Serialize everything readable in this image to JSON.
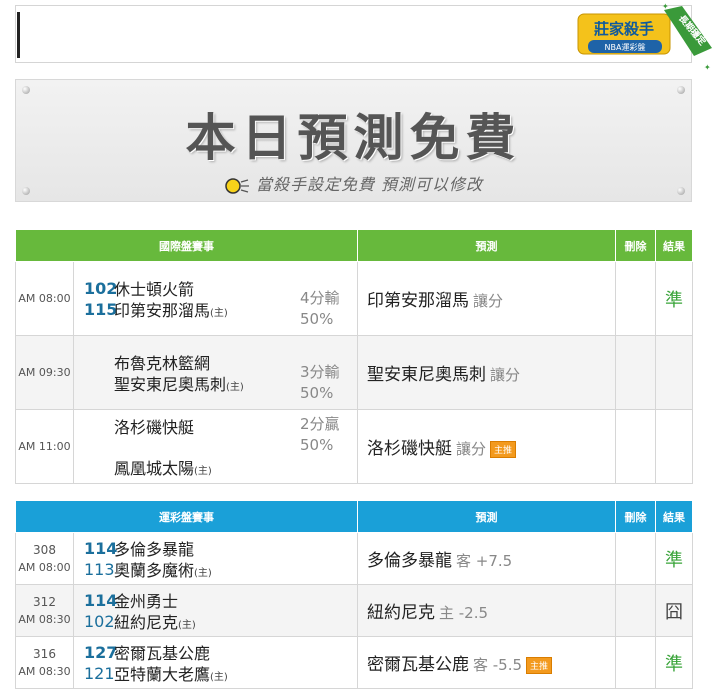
{
  "badge": {
    "main": "莊家殺手",
    "sub": "NBA運彩盤",
    "ribbon": "長期穩定"
  },
  "banner": {
    "title": "本日預測免費",
    "subtitle": "當殺手設定免費  預測可以修改"
  },
  "intl_table": {
    "headers": {
      "match": "國際盤賽事",
      "pred": "預測",
      "del": "刪除",
      "result": "結果"
    },
    "rows": [
      {
        "time": "AM 08:00",
        "team1_no": "102",
        "team1": "休士頓火箭",
        "team2_no": "115",
        "team2": "印第安那溜馬",
        "host": "(主)",
        "odds1": "4分輸",
        "odds2": "50%",
        "pred": "印第安那溜馬",
        "pred_sub": "讓分",
        "result": "準"
      },
      {
        "time": "AM 09:30",
        "team1": "布魯克林籃網",
        "team2": "聖安東尼奧馬刺",
        "host": "(主)",
        "odds1": "3分輸",
        "odds2": "50%",
        "pred": "聖安東尼奧馬刺",
        "pred_sub": "讓分"
      },
      {
        "time": "AM 11:00",
        "team1": "洛杉磯快艇",
        "team2": "鳳凰城太陽",
        "host": "(主)",
        "odds1": "2分贏",
        "odds2": "50%",
        "pred": "洛杉磯快艇",
        "pred_sub": "讓分",
        "tag": "主推"
      }
    ]
  },
  "sport_table": {
    "headers": {
      "match": "運彩盤賽事",
      "pred": "預測",
      "del": "刪除",
      "result": "結果"
    },
    "rows": [
      {
        "num": "308",
        "time": "AM 08:00",
        "team1_no": "114",
        "team1": "多倫多暴龍",
        "team2_no": "113",
        "team2": "奧蘭多魔術",
        "host": "(主)",
        "pred": "多倫多暴龍",
        "pred_sub": "客 +7.5",
        "result": "準"
      },
      {
        "num": "312",
        "time": "AM 08:30",
        "team1_no": "114",
        "team1": "金州勇士",
        "team2_no": "102",
        "team2": "紐約尼克",
        "host": "(主)",
        "pred": "紐約尼克",
        "pred_sub": "主 -2.5",
        "result": "囧"
      },
      {
        "num": "316",
        "time": "AM 08:30",
        "team1_no": "127",
        "team1": "密爾瓦基公鹿",
        "team2_no": "121",
        "team2": "亞特蘭大老鷹",
        "host": "(主)",
        "pred": "密爾瓦基公鹿",
        "pred_sub": "客 -5.5",
        "tag": "主推",
        "result": "準"
      }
    ]
  }
}
